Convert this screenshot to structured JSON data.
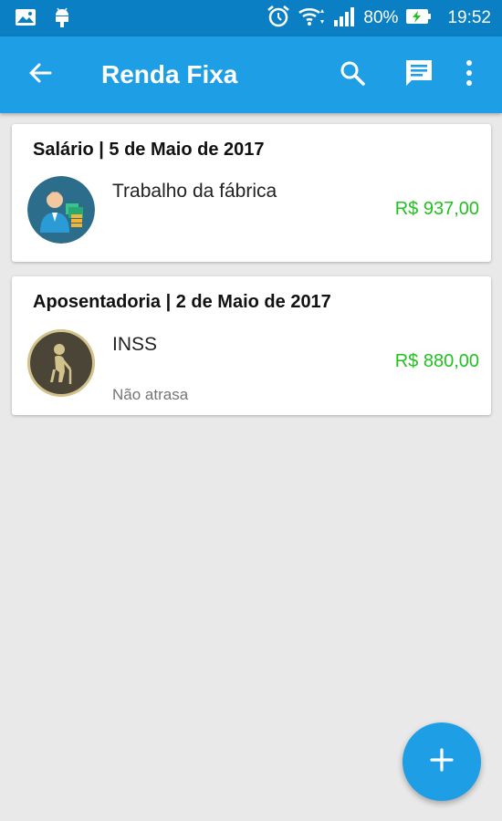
{
  "status_bar": {
    "battery": "80%",
    "time": "19:52",
    "icons": [
      "gallery-icon",
      "android-icon",
      "alarm-icon",
      "wifi-icon",
      "signal-icon",
      "battery-charging-icon"
    ]
  },
  "app_bar": {
    "title": "Renda Fixa",
    "back_icon": "arrow-back-icon",
    "actions": [
      "search-icon",
      "message-icon",
      "more-vert-icon"
    ]
  },
  "cards": [
    {
      "header": "Salário | 5 de Maio de 2017",
      "description": "Trabalho da fábrica",
      "amount": "R$ 937,00",
      "avatar": "worker-avatar-icon"
    },
    {
      "header": "Aposentadoria | 2 de Maio de 2017",
      "description": "INSS",
      "amount": "R$ 880,00",
      "note": "Não atrasa",
      "avatar": "elderly-avatar-icon"
    }
  ],
  "fab": {
    "icon": "plus-icon"
  },
  "colors": {
    "status_bar": "#0a7fc4",
    "app_bar": "#1e9ee4",
    "amount": "#21c21f",
    "background": "#e9e9e9"
  }
}
